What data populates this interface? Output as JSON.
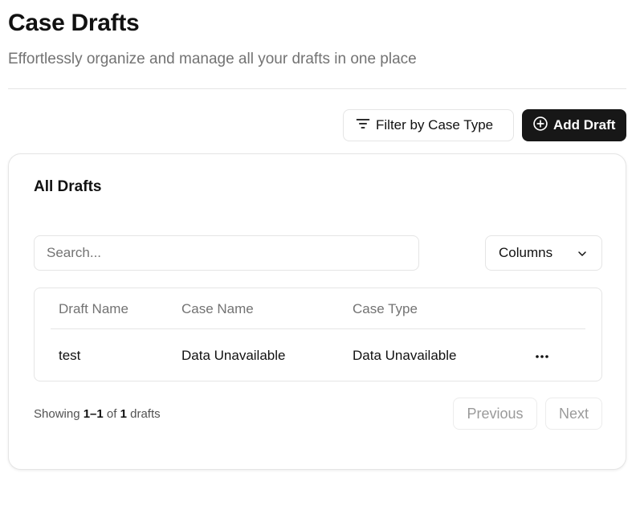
{
  "header": {
    "title": "Case Drafts",
    "subtitle": "Effortlessly organize and manage all your drafts in one place"
  },
  "toolbar": {
    "filter_label": "Filter by Case Type",
    "add_label": "Add Draft"
  },
  "card": {
    "title": "All Drafts",
    "search_placeholder": "Search...",
    "columns_label": "Columns"
  },
  "table": {
    "headers": [
      "Draft Name",
      "Case Name",
      "Case Type"
    ],
    "rows": [
      {
        "draft_name": "test",
        "case_name": "Data Unavailable",
        "case_type": "Data Unavailable"
      }
    ]
  },
  "pagination": {
    "showing_prefix": "Showing",
    "range": "1–1",
    "of": "of",
    "total": "1",
    "unit": "drafts",
    "previous_label": "Previous",
    "next_label": "Next"
  },
  "colors": {
    "primary_button": "#171717",
    "border": "#e5e5e5",
    "muted_text": "#737373"
  },
  "icons": {
    "filter": "filter-lines-icon",
    "add": "plus-circle-icon",
    "columns": "chevron-down-icon",
    "row_actions": "more-horizontal-icon"
  }
}
